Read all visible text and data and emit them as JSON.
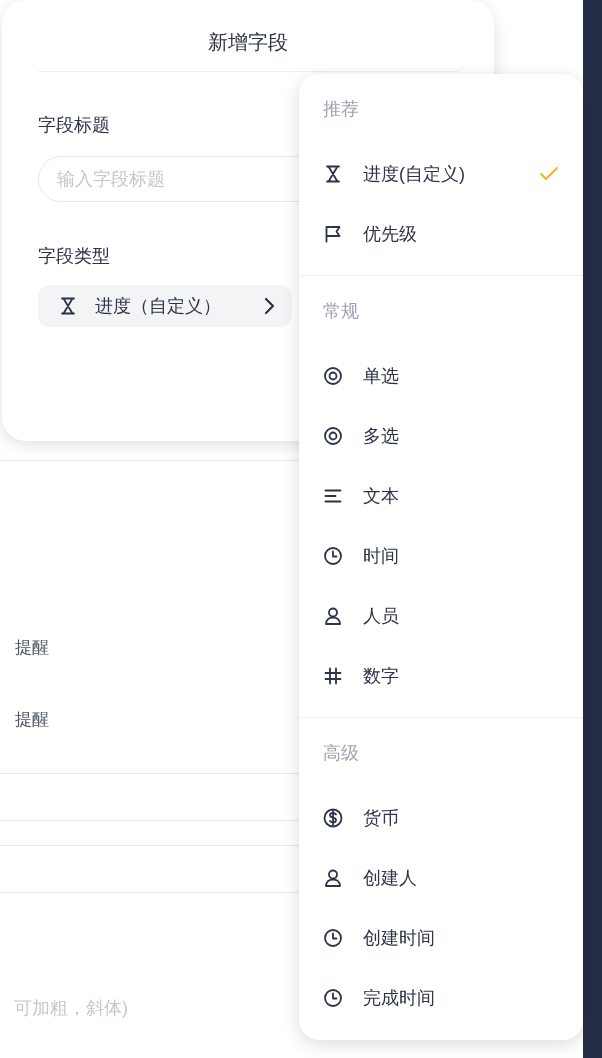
{
  "background": {
    "reminders": [
      "提醒",
      "提醒"
    ],
    "note_placeholder": "可加粗，斜体)"
  },
  "dialog": {
    "title": "新增字段",
    "title_label": "字段标题",
    "title_placeholder": "输入字段标题",
    "type_label": "字段类型",
    "type_value": {
      "kind": "progress",
      "label": "进度（自定义）"
    }
  },
  "menu": {
    "sections": [
      {
        "header": "推荐",
        "items": [
          {
            "kind": "progress",
            "label": "进度(自定义)",
            "selected": true
          },
          {
            "kind": "priority",
            "label": "优先级",
            "selected": false
          }
        ]
      },
      {
        "header": "常规",
        "items": [
          {
            "kind": "single",
            "label": "单选",
            "selected": false
          },
          {
            "kind": "multi",
            "label": "多选",
            "selected": false
          },
          {
            "kind": "text",
            "label": "文本",
            "selected": false
          },
          {
            "kind": "time",
            "label": "时间",
            "selected": false
          },
          {
            "kind": "person",
            "label": "人员",
            "selected": false
          },
          {
            "kind": "number",
            "label": "数字",
            "selected": false
          }
        ]
      },
      {
        "header": "高级",
        "items": [
          {
            "kind": "currency",
            "label": "货币",
            "selected": false
          },
          {
            "kind": "creator",
            "label": "创建人",
            "selected": false
          },
          {
            "kind": "created_time",
            "label": "创建时间",
            "selected": false
          },
          {
            "kind": "done_time",
            "label": "完成时间",
            "selected": false
          }
        ]
      }
    ]
  }
}
